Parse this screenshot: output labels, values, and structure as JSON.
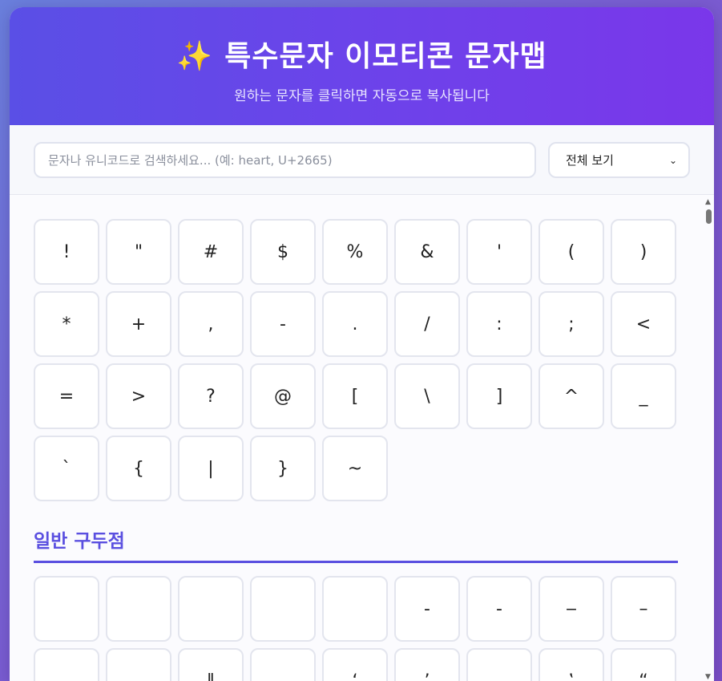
{
  "header": {
    "icon": "✨",
    "title": "특수문자 이모티콘 문자맵",
    "subtitle": "원하는 문자를 클릭하면 자동으로 복사됩니다"
  },
  "search": {
    "placeholder": "문자나 유니코드로 검색하세요... (예: heart, U+2665)",
    "value": ""
  },
  "filter": {
    "selected": "전체 보기"
  },
  "basic_symbols": [
    "!",
    "\"",
    "#",
    "$",
    "%",
    "&",
    "'",
    "(",
    ")",
    "*",
    "+",
    ",",
    "-",
    ".",
    "/",
    ":",
    ";",
    "<",
    "=",
    ">",
    "?",
    "@",
    "[",
    "\\",
    "]",
    "^",
    "_",
    "`",
    "{",
    "|",
    "}",
    "~"
  ],
  "section_punctuation": {
    "title": "일반 구두점",
    "row1": [
      " ",
      " ",
      " ",
      " ",
      " ",
      "‐",
      "‑",
      "‒",
      "–"
    ],
    "row2": [
      " ",
      " ",
      "‖",
      " ",
      "‘",
      "’",
      " ",
      "‛",
      "“"
    ]
  },
  "colors": {
    "accent": "#5a4fe0",
    "header_start": "#5a4fe6",
    "header_end": "#7a37ea"
  }
}
